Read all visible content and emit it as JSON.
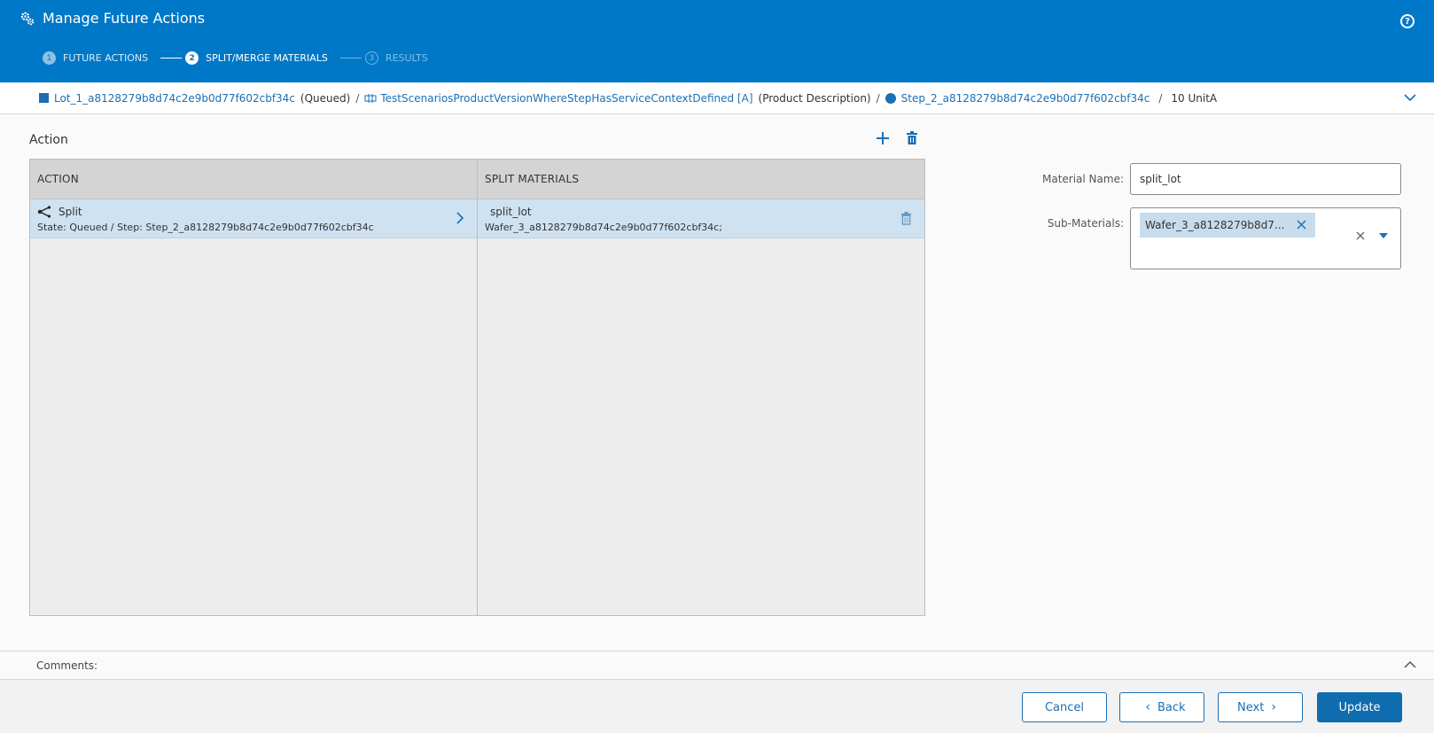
{
  "header": {
    "title": "Manage Future Actions",
    "title_icon": "gears-icon",
    "help_icon": "question-circle-icon"
  },
  "steps": [
    {
      "number": "1",
      "label": "FUTURE ACTIONS",
      "state": "done"
    },
    {
      "number": "2",
      "label": "SPLIT/MERGE MATERIALS",
      "state": "active"
    },
    {
      "number": "3",
      "label": "RESULTS",
      "state": "todo"
    }
  ],
  "breadcrumb": {
    "lot": "Lot_1_a8128279b8d74c2e9b0d77f602cbf34c",
    "lot_state": "(Queued)",
    "product": "TestScenariosProductVersionWhereStepHasServiceContextDefined [A]",
    "product_desc": "(Product Description)",
    "step": "Step_2_a8128279b8d74c2e9b0d77f602cbf34c",
    "quantity": "10 UnitA",
    "separator": "/"
  },
  "action_section": {
    "title": "Action",
    "columns": {
      "action": "ACTION",
      "split_materials": "SPLIT MATERIALS"
    },
    "action_row": {
      "name": "Split",
      "detail": "State: Queued / Step: Step_2_a8128279b8d74c2e9b0d77f602cbf34c"
    },
    "split_row": {
      "name": "split_lot",
      "detail": "Wafer_3_a8128279b8d74c2e9b0d77f602cbf34c;"
    }
  },
  "form": {
    "material_name_label": "Material Name:",
    "material_name_value": "split_lot",
    "sub_materials_label": "Sub-Materials:",
    "sub_materials_chip": "Wafer_3_a8128279b8d7..."
  },
  "comments": {
    "label": "Comments:"
  },
  "footer": {
    "cancel": "Cancel",
    "back": "Back",
    "next": "Next",
    "update": "Update"
  },
  "colors": {
    "header_bg": "#0078c8",
    "accent": "#1a6fb5",
    "selected_row": "#cfe2f1",
    "primary_button": "#0f6cae"
  }
}
